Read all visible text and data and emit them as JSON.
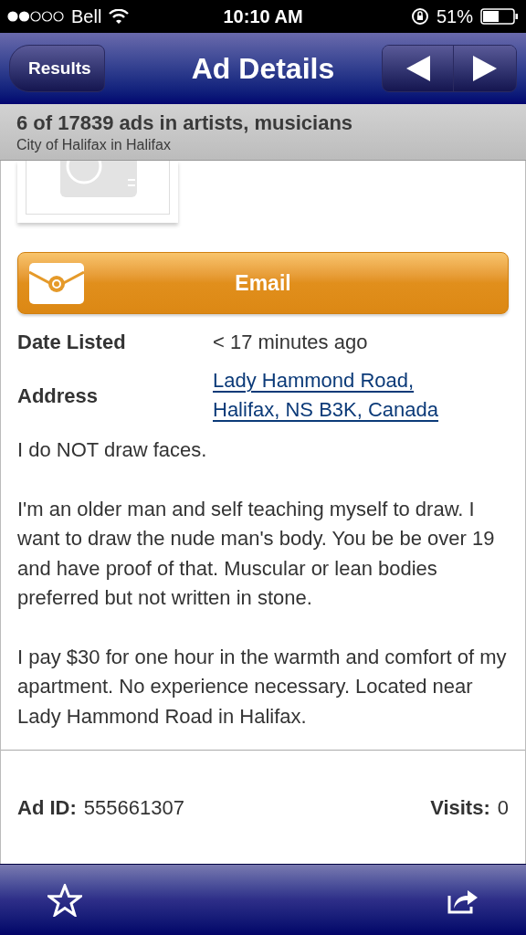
{
  "status_bar": {
    "carrier": "Bell",
    "time": "10:10 AM",
    "battery": "51%"
  },
  "nav_bar": {
    "back": "Results",
    "title": "Ad Details"
  },
  "subheader": {
    "title": "6 of 17839 ads in artists, musicians",
    "location": "City of Halifax in Halifax"
  },
  "email_button": {
    "label": "Email"
  },
  "details": [
    {
      "label": "Date Listed",
      "value": "< 17 minutes ago",
      "kind": "text"
    },
    {
      "label": "Address",
      "value": [
        "Lady Hammond Road,",
        "Halifax, NS B3K, Canada"
      ],
      "kind": "link"
    }
  ],
  "description": [
    "I do NOT draw faces.",
    "I'm an older man and self teaching myself to draw. I want to draw the nude man's body. You be be over 19 and have proof of that. Muscular or lean bodies preferred but not written in stone.",
    "I pay $30 for one hour in the warmth and comfort of my apartment. No experience necessary. Located near Lady Hammond Road in Halifax."
  ],
  "footer": {
    "ad_id_label": "Ad ID:",
    "ad_id": "555661307",
    "visits_label": "Visits:",
    "visits": "0"
  }
}
